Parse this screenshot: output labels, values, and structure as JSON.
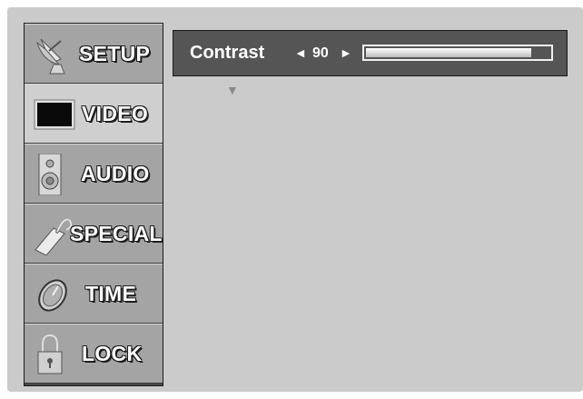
{
  "menu": {
    "items": [
      {
        "label": "SETUP",
        "icon": "satellite-dish-icon",
        "selected": false
      },
      {
        "label": "VIDEO",
        "icon": "tv-screen-icon",
        "selected": true
      },
      {
        "label": "AUDIO",
        "icon": "speaker-icon",
        "selected": false
      },
      {
        "label": "SPECIAL",
        "icon": "tag-icon",
        "selected": false
      },
      {
        "label": "TIME",
        "icon": "clock-icon",
        "selected": false
      },
      {
        "label": "LOCK",
        "icon": "padlock-icon",
        "selected": false
      }
    ]
  },
  "adjust": {
    "label": "Contrast",
    "left_arrow": "◄",
    "value": "90",
    "right_arrow": "►",
    "level_fraction": 0.9,
    "down_arrow": "▼"
  }
}
